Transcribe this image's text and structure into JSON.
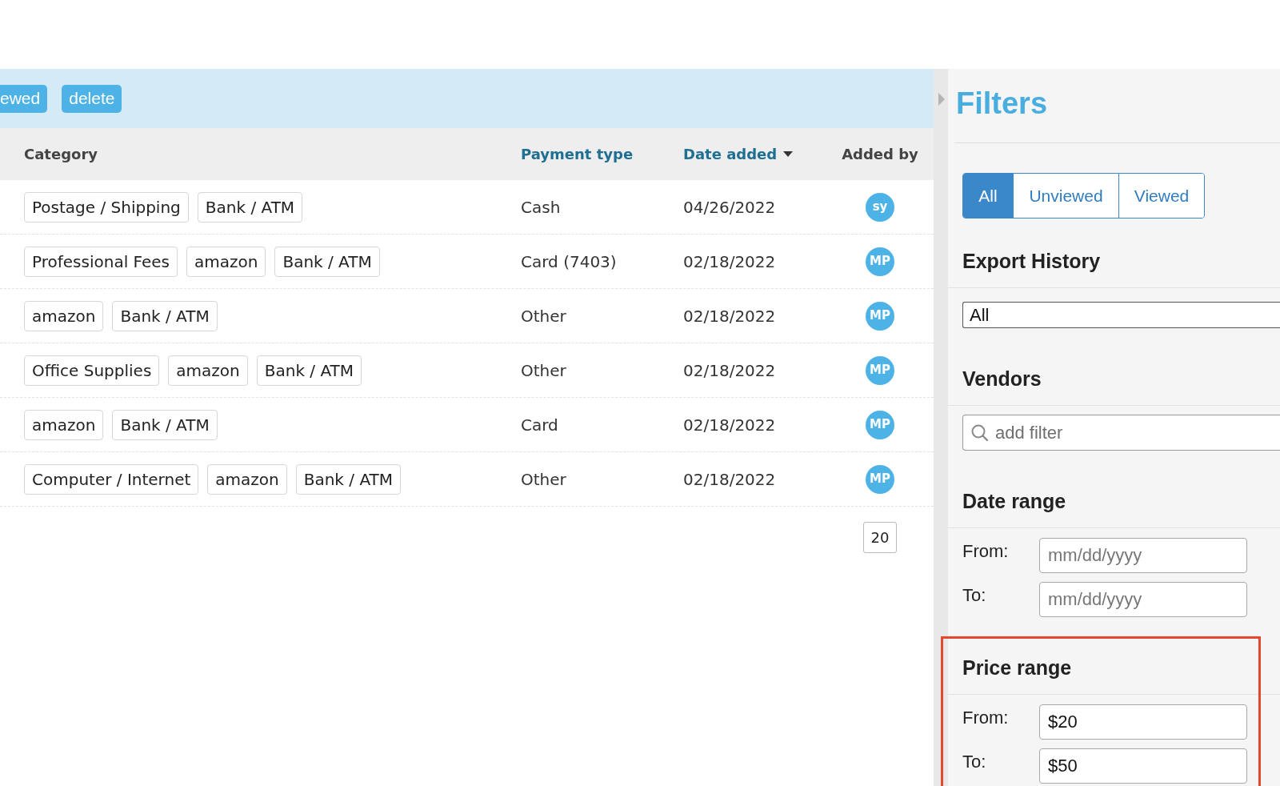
{
  "toolbar": {
    "buttons": [
      {
        "label": "ewed"
      },
      {
        "label": "delete"
      }
    ]
  },
  "table": {
    "columns": [
      {
        "label": "Category",
        "sortable": false,
        "sorted": false
      },
      {
        "label": "Payment type",
        "sortable": true,
        "sorted": false
      },
      {
        "label": "Date added",
        "sortable": true,
        "sorted": true
      },
      {
        "label": "Added by",
        "sortable": false,
        "sorted": false
      }
    ],
    "rows": [
      {
        "category_tags": [
          "Postage / Shipping",
          "Bank / ATM"
        ],
        "payment_type": "Cash",
        "date_added": "04/26/2022",
        "added_by": "sy"
      },
      {
        "category_tags": [
          "Professional Fees",
          "amazon",
          "Bank / ATM"
        ],
        "payment_type": "Card (7403)",
        "date_added": "02/18/2022",
        "added_by": "MP"
      },
      {
        "category_tags": [
          "amazon",
          "Bank / ATM"
        ],
        "payment_type": "Other",
        "date_added": "02/18/2022",
        "added_by": "MP"
      },
      {
        "category_tags": [
          "Office Supplies",
          "amazon",
          "Bank / ATM"
        ],
        "payment_type": "Other",
        "date_added": "02/18/2022",
        "added_by": "MP"
      },
      {
        "category_tags": [
          "amazon",
          "Bank / ATM"
        ],
        "payment_type": "Card",
        "date_added": "02/18/2022",
        "added_by": "MP"
      },
      {
        "category_tags": [
          "Computer / Internet",
          "amazon",
          "Bank / ATM"
        ],
        "payment_type": "Other",
        "date_added": "02/18/2022",
        "added_by": "MP"
      }
    ],
    "page_size": "20"
  },
  "filters": {
    "title": "Filters",
    "view_toggle": [
      {
        "label": "All",
        "selected": true
      },
      {
        "label": "Unviewed",
        "selected": false
      },
      {
        "label": "Viewed",
        "selected": false
      }
    ],
    "sections": [
      {
        "kind": "select",
        "heading": "Export History",
        "value": "All",
        "highlighted": false
      },
      {
        "kind": "search",
        "heading": "Vendors",
        "placeholder": "add filter",
        "highlighted": false
      },
      {
        "kind": "range",
        "heading": "Date range",
        "highlighted": false,
        "fields": [
          {
            "label": "From:",
            "placeholder": "mm/dd/yyyy"
          },
          {
            "label": "To:",
            "placeholder": "mm/dd/yyyy"
          }
        ]
      },
      {
        "kind": "range",
        "heading": "Price range",
        "highlighted": true,
        "fields": [
          {
            "label": "From:",
            "value": "$20"
          },
          {
            "label": "To:",
            "value": "$50"
          }
        ]
      }
    ]
  }
}
